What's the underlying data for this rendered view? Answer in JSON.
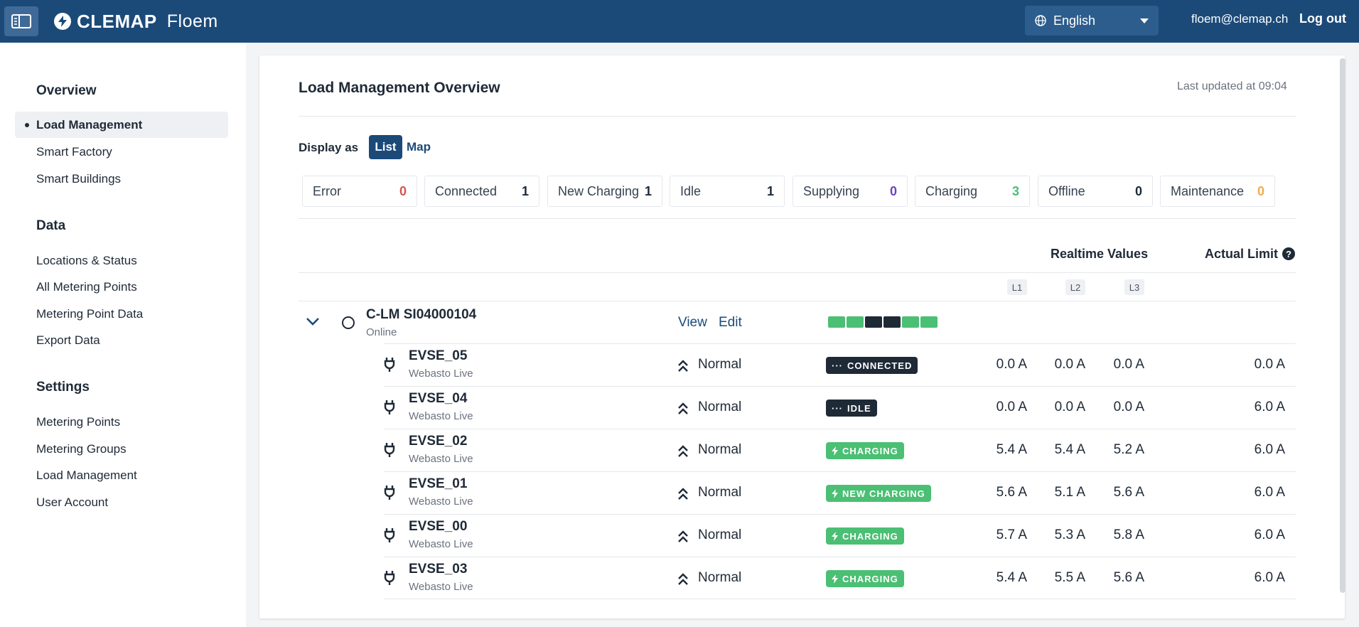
{
  "header": {
    "brand_name": "CLEMAP",
    "brand_product": "Floem",
    "language": "English",
    "user_email": "floem@clemap.ch",
    "logout_label": "Log out"
  },
  "sidebar": {
    "sections": [
      {
        "title": "Overview",
        "items": [
          "Load Management",
          "Smart Factory",
          "Smart Buildings"
        ]
      },
      {
        "title": "Data",
        "items": [
          "Locations & Status",
          "All Metering Points",
          "Metering Point Data",
          "Export Data"
        ]
      },
      {
        "title": "Settings",
        "items": [
          "Metering Points",
          "Metering Groups",
          "Load Management",
          "User Account"
        ]
      }
    ],
    "active_item": "Load Management"
  },
  "main": {
    "title": "Load Management Overview",
    "last_updated": "Last updated at 09:04",
    "display_as_label": "Display as",
    "view_list": "List",
    "view_map": "Map",
    "stats": [
      {
        "label": "Error",
        "count": "0",
        "color": "#d9534f"
      },
      {
        "label": "Connected",
        "count": "1",
        "color": "#1f2a37"
      },
      {
        "label": "New Charging",
        "count": "1",
        "color": "#1f2a37"
      },
      {
        "label": "Idle",
        "count": "1",
        "color": "#1f2a37"
      },
      {
        "label": "Supplying",
        "count": "0",
        "color": "#6f42c1"
      },
      {
        "label": "Charging",
        "count": "3",
        "color": "#4bbf73"
      },
      {
        "label": "Offline",
        "count": "0",
        "color": "#1f2a37"
      },
      {
        "label": "Maintenance",
        "count": "0",
        "color": "#f0ad4e"
      }
    ],
    "columns": {
      "realtime": "Realtime Values",
      "actual_limit": "Actual Limit",
      "phases": [
        "L1",
        "L2",
        "L3"
      ]
    },
    "group": {
      "name": "C-LM SI04000104",
      "status": "Online",
      "view_label": "View",
      "edit_label": "Edit",
      "segments": [
        "#4bbf73",
        "#4bbf73",
        "#1f2a37",
        "#1f2a37",
        "#4bbf73",
        "#4bbf73"
      ]
    },
    "rows": [
      {
        "name": "EVSE_05",
        "model": "Webasto Live",
        "mode": "Normal",
        "state": "CONNECTED",
        "style": "dark",
        "l1": "0.0 A",
        "l2": "0.0 A",
        "l3": "0.0 A",
        "limit": "0.0 A"
      },
      {
        "name": "EVSE_04",
        "model": "Webasto Live",
        "mode": "Normal",
        "state": "IDLE",
        "style": "dark",
        "l1": "0.0 A",
        "l2": "0.0 A",
        "l3": "0.0 A",
        "limit": "6.0 A"
      },
      {
        "name": "EVSE_02",
        "model": "Webasto Live",
        "mode": "Normal",
        "state": "CHARGING",
        "style": "green",
        "l1": "5.4 A",
        "l2": "5.4 A",
        "l3": "5.2 A",
        "limit": "6.0 A"
      },
      {
        "name": "EVSE_01",
        "model": "Webasto Live",
        "mode": "Normal",
        "state": "NEW CHARGING",
        "style": "green",
        "l1": "5.6 A",
        "l2": "5.1 A",
        "l3": "5.6 A",
        "limit": "6.0 A"
      },
      {
        "name": "EVSE_00",
        "model": "Webasto Live",
        "mode": "Normal",
        "state": "CHARGING",
        "style": "green",
        "l1": "5.7 A",
        "l2": "5.3 A",
        "l3": "5.8 A",
        "limit": "6.0 A"
      },
      {
        "name": "EVSE_03",
        "model": "Webasto Live",
        "mode": "Normal",
        "state": "CHARGING",
        "style": "green",
        "l1": "5.4 A",
        "l2": "5.5 A",
        "l3": "5.6 A",
        "limit": "6.0 A"
      }
    ]
  }
}
